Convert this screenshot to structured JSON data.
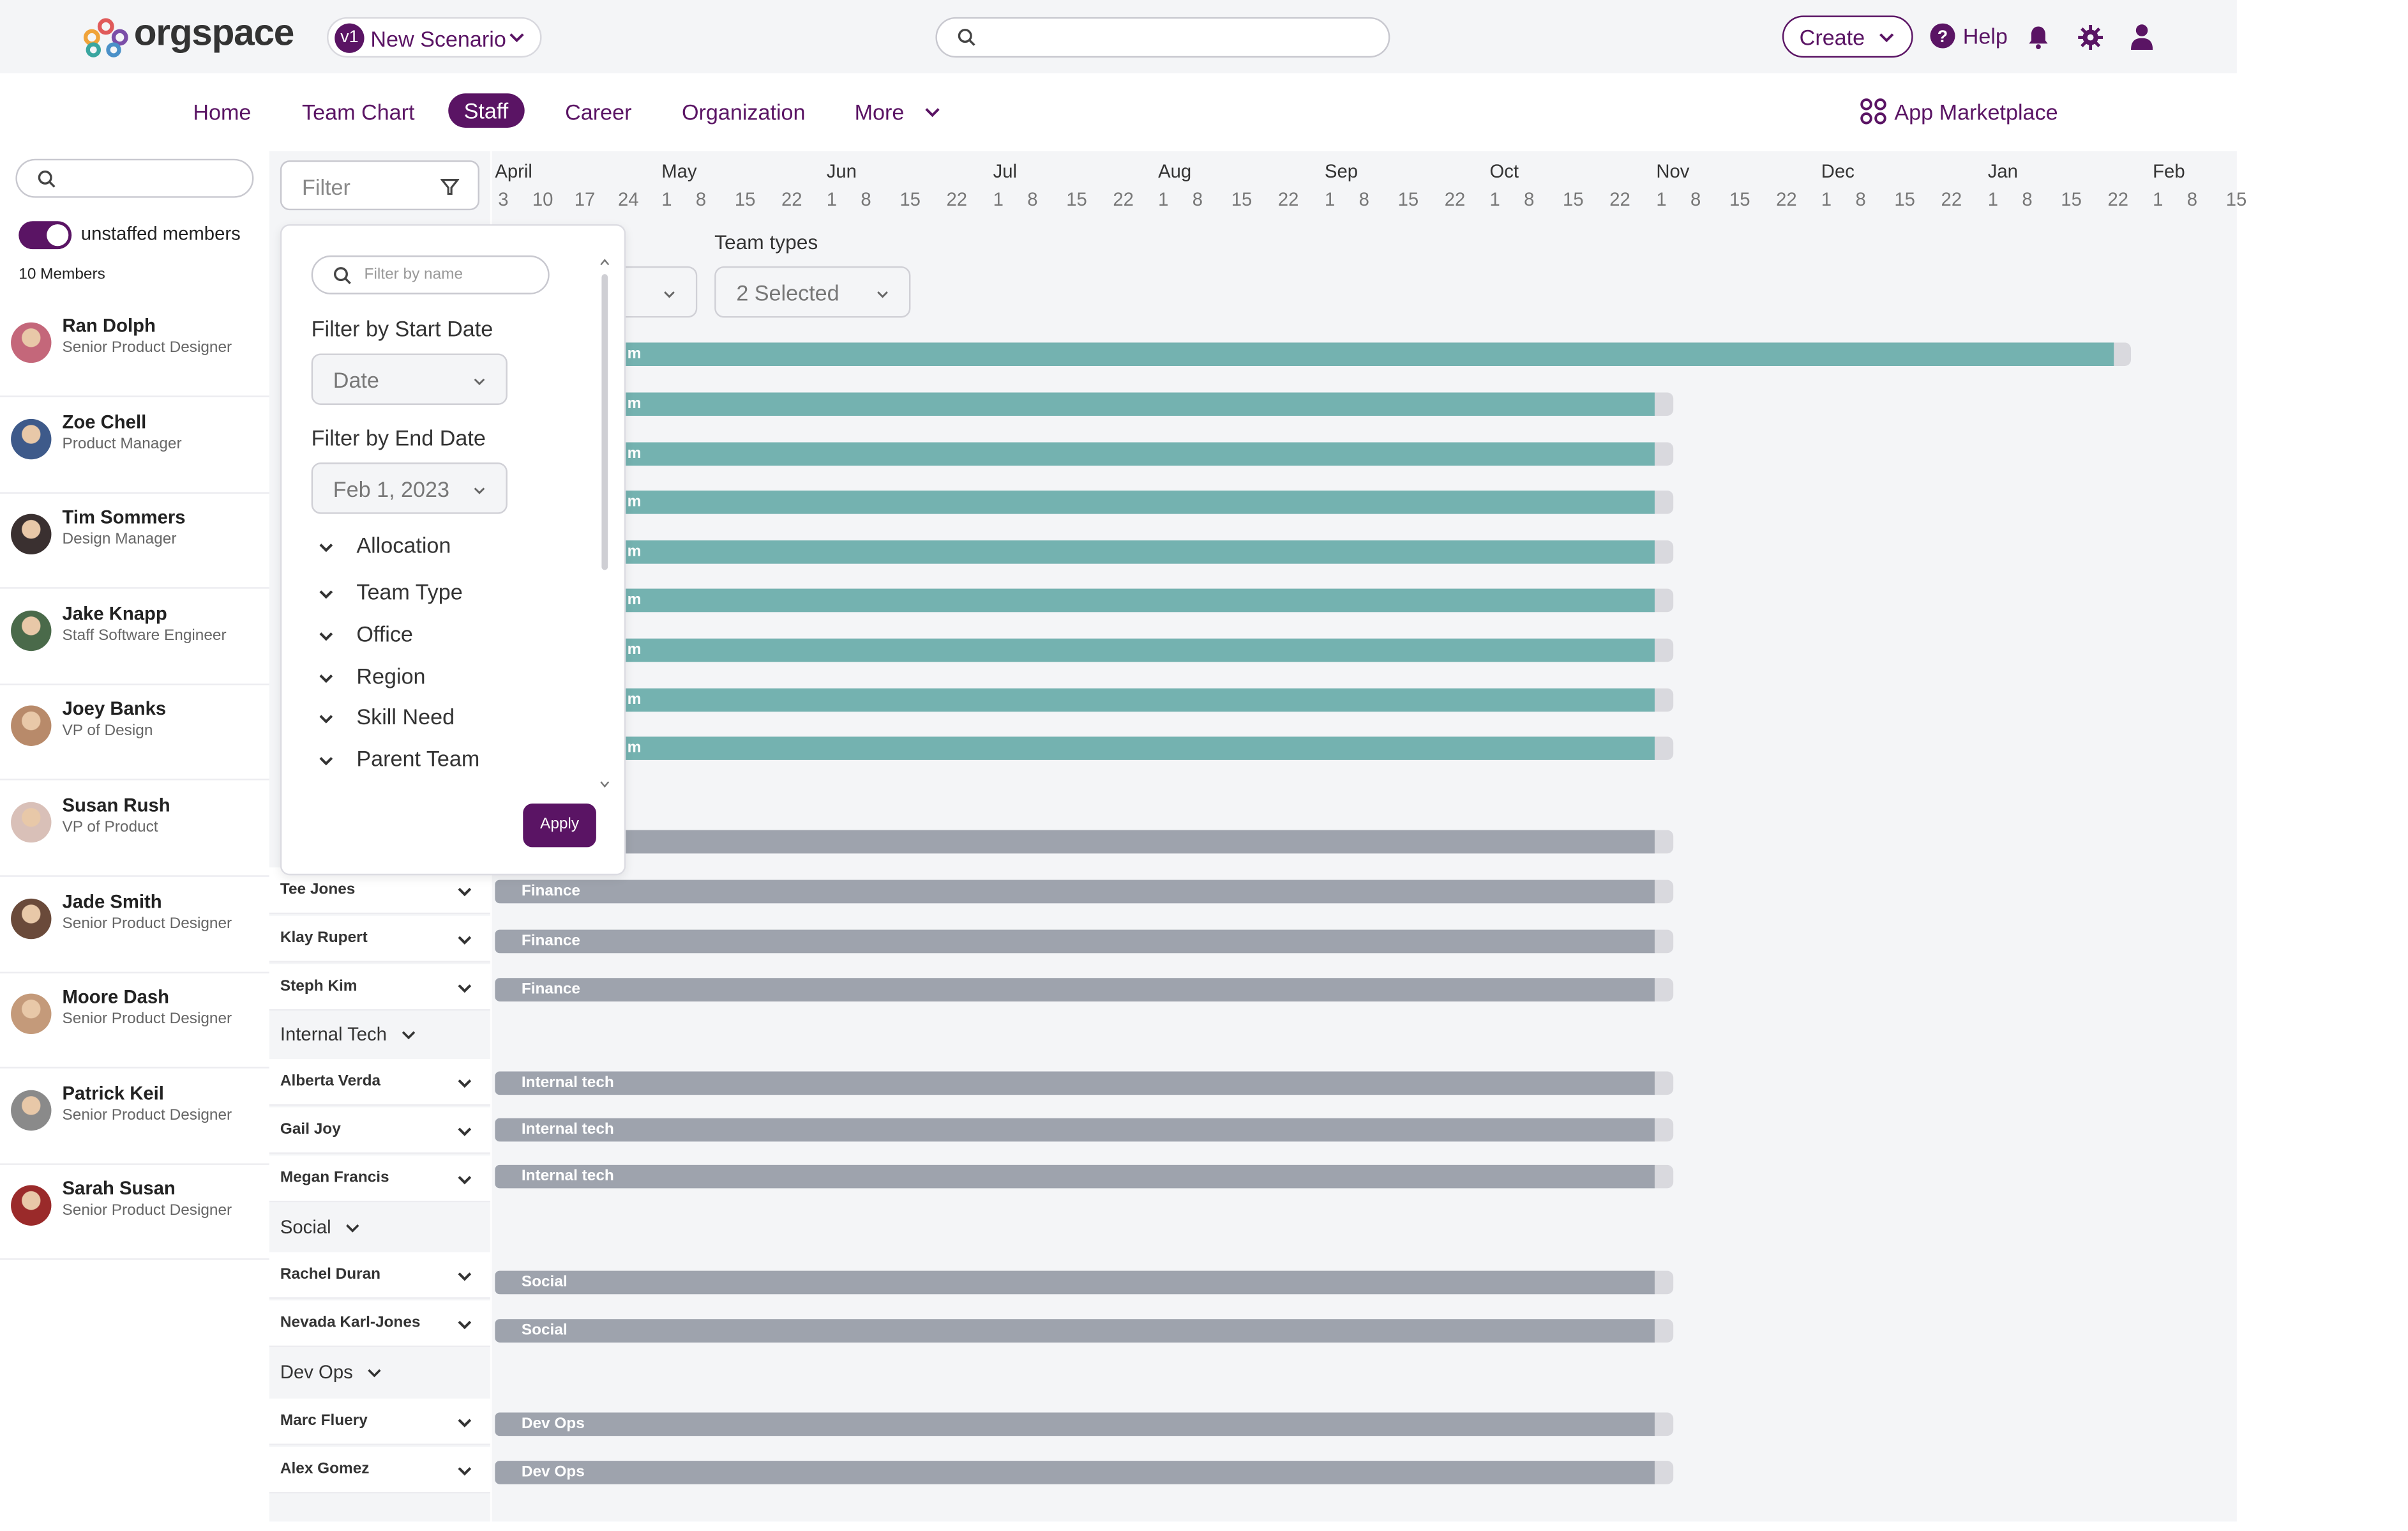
{
  "app": {
    "logo_text": "orgspace",
    "scenario": {
      "version": "v1",
      "name": "New Scenario"
    },
    "create_label": "Create",
    "help_label": "Help",
    "brand_color": "#5a1464"
  },
  "nav": {
    "items": [
      "Home",
      "Team Chart",
      "Staff",
      "Career",
      "Organization",
      "More"
    ],
    "active": "Staff",
    "marketplace_label": "App Marketplace"
  },
  "sidebar": {
    "search_placeholder": "",
    "toggle_label": "unstaffed members",
    "toggle_on": true,
    "members_count": "10 Members",
    "members": [
      {
        "name": "Ran Dolph",
        "role": "Senior Product Designer"
      },
      {
        "name": "Zoe Chell",
        "role": "Product Manager"
      },
      {
        "name": "Tim Sommers",
        "role": "Design Manager"
      },
      {
        "name": "Jake Knapp",
        "role": "Staff Software Engineer"
      },
      {
        "name": "Joey Banks",
        "role": "VP of Design"
      },
      {
        "name": "Susan Rush",
        "role": "VP of Product"
      },
      {
        "name": "Jade Smith",
        "role": "Senior Product Designer"
      },
      {
        "name": "Moore Dash",
        "role": "Senior Product Designer"
      },
      {
        "name": "Patrick Keil",
        "role": "Senior Product Designer"
      },
      {
        "name": "Sarah Susan",
        "role": "Senior Product Designer"
      }
    ]
  },
  "filter": {
    "button_label": "Filter",
    "name_placeholder": "Filter by name",
    "start_date_label": "Filter by Start Date",
    "start_date_value": "Date",
    "end_date_label": "Filter by End Date",
    "end_date_value": "Feb 1, 2023",
    "sections": [
      "Allocation",
      "Team Type",
      "Office",
      "Region",
      "Skill Need",
      "Parent Team"
    ],
    "apply_label": "Apply",
    "team_types_label": "Team types",
    "team_types_value": "2 Selected"
  },
  "timeline": {
    "months": [
      "April",
      "May",
      "Jun",
      "Jul",
      "Aug",
      "Sep",
      "Oct",
      "Nov",
      "Dec",
      "Jan",
      "Feb"
    ],
    "days": [
      [
        "3",
        "10",
        "17",
        "24"
      ],
      [
        "1",
        "8",
        "15",
        "22"
      ],
      [
        "1",
        "8",
        "15",
        "22"
      ],
      [
        "1",
        "8",
        "15",
        "22"
      ],
      [
        "1",
        "8",
        "15",
        "22"
      ],
      [
        "1",
        "8",
        "15",
        "22"
      ],
      [
        "1",
        "8",
        "15",
        "22"
      ],
      [
        "1",
        "8",
        "15",
        "22"
      ],
      [
        "1",
        "8",
        "15",
        "22"
      ],
      [
        "1",
        "8",
        "15",
        "22"
      ],
      [
        "1",
        "8",
        "15"
      ]
    ]
  },
  "rows": {
    "visible_rows": [
      {
        "name": "Tee Jones",
        "bar_label": "Finance"
      },
      {
        "name": "Klay Rupert",
        "bar_label": "Finance"
      },
      {
        "name": "Steph Kim",
        "bar_label": "Finance"
      },
      {
        "name": "Alberta Verda",
        "bar_label": "Internal tech"
      },
      {
        "name": "Gail Joy",
        "bar_label": "Internal tech"
      },
      {
        "name": "Megan Francis",
        "bar_label": "Internal tech"
      },
      {
        "name": "Rachel Duran",
        "bar_label": "Social"
      },
      {
        "name": "Nevada Karl-Jones",
        "bar_label": "Social"
      },
      {
        "name": "Marc Fluery",
        "bar_label": "Dev Ops"
      },
      {
        "name": "Alex Gomez",
        "bar_label": "Dev Ops"
      }
    ],
    "groups": [
      "Internal Tech",
      "Social",
      "Dev Ops"
    ],
    "teal_bar_fragment": "m",
    "teal_color": "#74b2b0",
    "gray_color": "#9ea3ad"
  }
}
